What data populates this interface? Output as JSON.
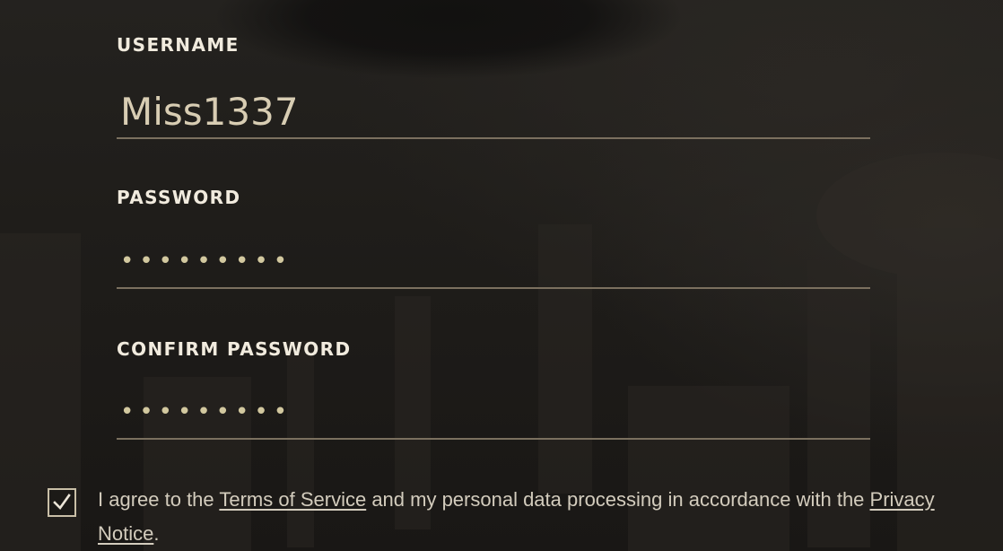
{
  "form": {
    "username": {
      "label": "USERNAME",
      "value": "Miss1337"
    },
    "password": {
      "label": "PASSWORD",
      "masked_value": "•••••••••"
    },
    "confirm_password": {
      "label": "CONFIRM PASSWORD",
      "masked_value": "•••••••••"
    }
  },
  "agreement": {
    "checked": true,
    "text_before_terms": "I agree to the ",
    "terms_link": "Terms of Service",
    "text_middle": " and my personal data processing in accordance with the ",
    "privacy_link": "Privacy Notice",
    "text_after": "."
  },
  "colors": {
    "background": "#1f1d1a",
    "label": "#f1ebde",
    "input_text": "#d8cdb3",
    "underline": "#7b705f",
    "checkbox_border": "#c9bfa7"
  },
  "icons": {
    "checkbox_mark": "checkmark-icon"
  }
}
